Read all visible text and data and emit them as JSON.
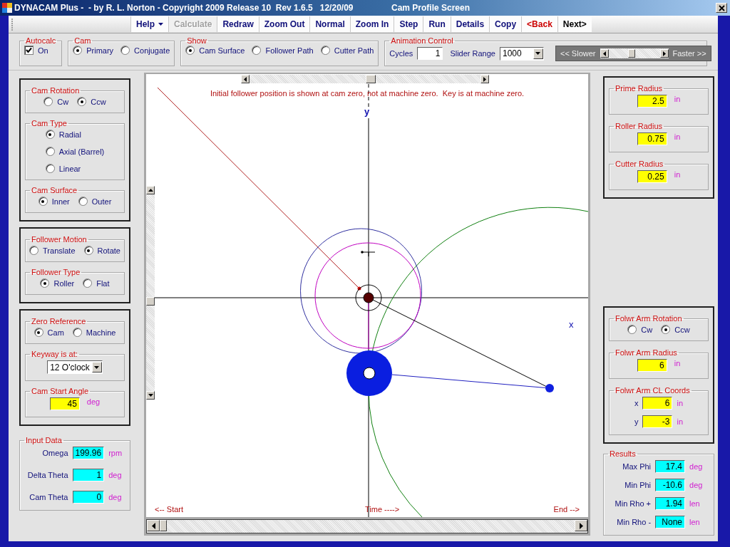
{
  "window": {
    "title": "DYNACAM Plus -  - by R. L. Norton - Copyright 2009 Release 10  Rev 1.6.5   12/20/09",
    "screen_title": "Cam Profile Screen"
  },
  "toolbar": [
    {
      "label": "Help",
      "kind": "menu",
      "disabled": false,
      "color": "#10107a"
    },
    {
      "label": "Calculate",
      "kind": "button",
      "disabled": true
    },
    {
      "label": "Redraw",
      "kind": "button",
      "disabled": false,
      "color": "#10107a"
    },
    {
      "label": "Zoom Out",
      "kind": "button",
      "disabled": false,
      "color": "#10107a"
    },
    {
      "label": "Normal",
      "kind": "button",
      "disabled": false,
      "color": "#10107a"
    },
    {
      "label": "Zoom In",
      "kind": "button",
      "disabled": false,
      "color": "#10107a"
    },
    {
      "label": "Step",
      "kind": "button",
      "disabled": false,
      "color": "#10107a"
    },
    {
      "label": "Run",
      "kind": "button",
      "disabled": false,
      "color": "#10107a"
    },
    {
      "label": "Details",
      "kind": "button",
      "disabled": false,
      "color": "#10107a"
    },
    {
      "label": "Copy",
      "kind": "button",
      "disabled": false,
      "color": "#10107a"
    },
    {
      "label": "<Back",
      "kind": "button",
      "disabled": false,
      "color": "#cc0000"
    },
    {
      "label": "Next>",
      "kind": "button",
      "disabled": false,
      "color": "#000000"
    }
  ],
  "top_bar": {
    "groups": [
      {
        "title": "Autocalc",
        "kind": "row",
        "items": [
          {
            "kind": "checkbox",
            "label": "On",
            "checked": true
          }
        ]
      },
      {
        "title": "Cam",
        "kind": "row",
        "items": [
          {
            "kind": "radio",
            "label": "Primary",
            "selected": true
          },
          {
            "kind": "radio",
            "label": "Conjugate",
            "selected": false
          }
        ]
      },
      {
        "title": "Show",
        "kind": "row",
        "items": [
          {
            "kind": "radio",
            "label": "Cam Surface",
            "selected": true
          },
          {
            "kind": "radio",
            "label": "Follower Path",
            "selected": false
          },
          {
            "kind": "radio",
            "label": "Cutter Path",
            "selected": false
          }
        ]
      },
      {
        "title": "Animation Control",
        "kind": "row",
        "items": [
          {
            "kind": "text_field",
            "label": "Cycles",
            "value": "1"
          },
          {
            "kind": "dropdown",
            "label": "Slider Range",
            "value": "1000"
          },
          {
            "kind": "slider",
            "left_label": "<< Slower",
            "right_label": "Faster >>",
            "level": 0.45
          }
        ]
      }
    ]
  },
  "left_column": [
    {
      "framed": true,
      "groups": [
        {
          "title": "Cam Rotation",
          "kind": "row",
          "items": [
            {
              "kind": "radio",
              "label": "Cw",
              "selected": false
            },
            {
              "kind": "radio",
              "label": "Ccw",
              "selected": true
            }
          ]
        },
        {
          "title": "Cam Type",
          "kind": "list",
          "items": [
            {
              "kind": "radio",
              "label": "Radial",
              "selected": true
            },
            {
              "kind": "radio",
              "label": "Axial (Barrel)",
              "selected": false
            },
            {
              "kind": "radio",
              "label": "Linear",
              "selected": false
            }
          ]
        },
        {
          "title": "Cam Surface",
          "kind": "row",
          "items": [
            {
              "kind": "radio",
              "label": "Inner",
              "selected": true
            },
            {
              "kind": "radio",
              "label": "Outer",
              "selected": false
            }
          ]
        }
      ]
    },
    {
      "framed": true,
      "groups": [
        {
          "title": "Follower Motion",
          "kind": "row",
          "items": [
            {
              "kind": "radio",
              "label": "Translate",
              "selected": false
            },
            {
              "kind": "radio",
              "label": "Rotate",
              "selected": true
            }
          ]
        },
        {
          "title": "Follower Type",
          "kind": "row",
          "items": [
            {
              "kind": "radio",
              "label": "Roller",
              "selected": true
            },
            {
              "kind": "radio",
              "label": "Flat",
              "selected": false
            }
          ]
        }
      ]
    },
    {
      "framed": true,
      "groups": [
        {
          "title": "Zero Reference",
          "kind": "row",
          "items": [
            {
              "kind": "radio",
              "label": "Cam",
              "selected": true
            },
            {
              "kind": "radio",
              "label": "Machine",
              "selected": false
            }
          ]
        },
        {
          "title": "Keyway is at:",
          "kind": "row",
          "items": [
            {
              "kind": "dropdown",
              "value": "12 O'clock"
            }
          ]
        },
        {
          "title": "Cam Start Angle",
          "kind": "row",
          "items": [
            {
              "kind": "input_field",
              "value": "45",
              "unit": "deg"
            }
          ]
        }
      ]
    },
    {
      "framed": false,
      "groups": [
        {
          "title": "Input Data",
          "kind": "list",
          "items": [
            {
              "kind": "output_field",
              "label": "Omega",
              "value": "199.96",
              "unit": "rpm"
            },
            {
              "kind": "output_field",
              "label": "Delta Theta",
              "value": "1",
              "unit": "deg"
            },
            {
              "kind": "output_field",
              "label": "Cam Theta",
              "value": "0",
              "unit": "deg"
            }
          ]
        }
      ]
    }
  ],
  "canvas": {
    "note": "Initial follower position is shown at cam zero, not at machine zero.  Key is at machine zero.",
    "y_axis_label": "y",
    "x_axis_label": "x",
    "start_label": "<-- Start",
    "time_label": "Time ---->",
    "end_label": "End -->"
  },
  "right_column": [
    {
      "framed": true,
      "groups": [
        {
          "title": "Prime Radius",
          "kind": "row",
          "items": [
            {
              "kind": "input_field",
              "value": "2.5",
              "unit": "in"
            }
          ]
        },
        {
          "title": "Roller Radius",
          "kind": "row",
          "items": [
            {
              "kind": "input_field",
              "value": "0.75",
              "unit": "in"
            }
          ]
        },
        {
          "title": "Cutter Radius",
          "kind": "row",
          "items": [
            {
              "kind": "input_field",
              "value": "0.25",
              "unit": "in"
            }
          ]
        }
      ]
    },
    {
      "framed": true,
      "groups": [
        {
          "title": "Folwr Arm Rotation",
          "kind": "row",
          "items": [
            {
              "kind": "radio",
              "label": "Cw",
              "selected": false
            },
            {
              "kind": "radio",
              "label": "Ccw",
              "selected": true
            }
          ]
        },
        {
          "title": "Folwr Arm Radius",
          "kind": "row",
          "items": [
            {
              "kind": "input_field",
              "value": "6",
              "unit": "in"
            }
          ]
        },
        {
          "title": "Folwr Arm CL Coords",
          "kind": "list",
          "items": [
            {
              "kind": "input_field",
              "label": "x",
              "value": "6",
              "unit": "in"
            },
            {
              "kind": "input_field",
              "label": "y",
              "value": "-3",
              "unit": "in"
            }
          ]
        }
      ]
    },
    {
      "framed": false,
      "groups": [
        {
          "title": "Results",
          "kind": "list",
          "items": [
            {
              "kind": "output_field",
              "label": "Max Phi",
              "value": "17.4",
              "unit": "deg"
            },
            {
              "kind": "output_field",
              "label": "Min Phi",
              "value": "-10.6",
              "unit": "deg"
            },
            {
              "kind": "output_field",
              "label": "Min Rho +",
              "value": "1.94",
              "unit": "len"
            },
            {
              "kind": "output_field",
              "label": "Min Rho -",
              "value": "None",
              "unit": "len"
            }
          ]
        }
      ]
    }
  ]
}
